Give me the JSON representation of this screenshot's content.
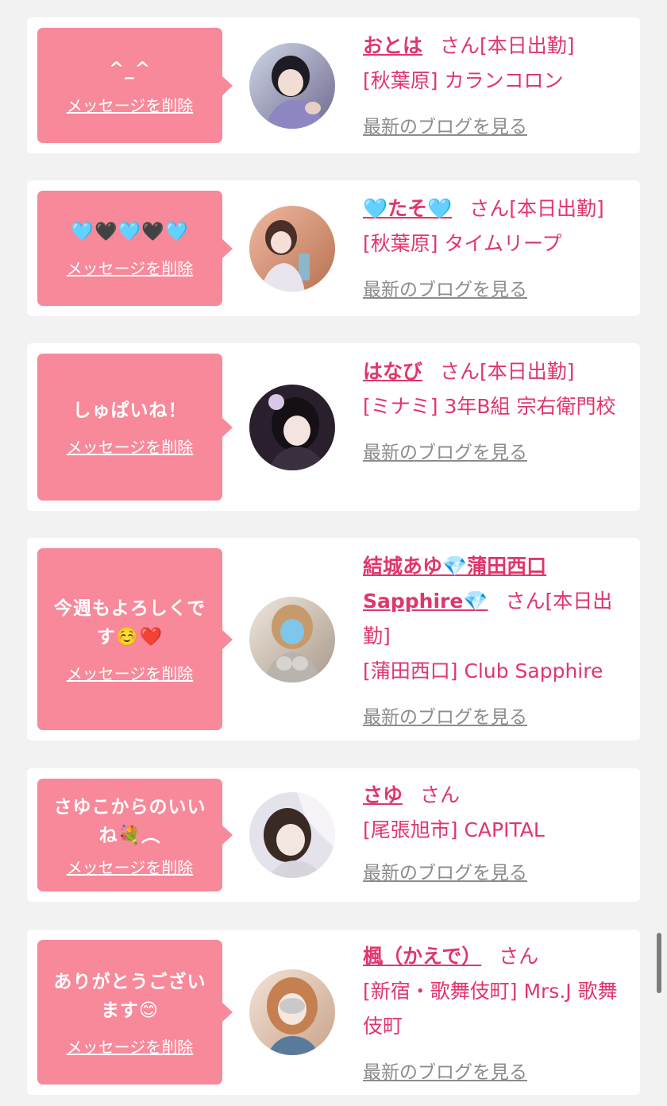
{
  "delete_label": "メッセージを削除",
  "blog_label": "最新のブログを見る",
  "san_suffix": "さん",
  "entries": [
    {
      "message": "^_^",
      "name": "おとは",
      "status": "[本日出勤]",
      "area_shop": "[秋葉原] カランコロン"
    },
    {
      "message": "🩵🖤🩵🖤🩵",
      "name": "🩵たそ🩵",
      "status": "[本日出勤]",
      "area_shop": "[秋葉原] タイムリープ"
    },
    {
      "message": "しゅぱいね！",
      "name": "はなび",
      "status": "[本日出勤]",
      "area_shop": "[ミナミ] 3年B組 宗右衛門校"
    },
    {
      "message": "今週もよろしくです☺️❤️",
      "name": "結城あゆ💎蒲田西口Sapphire💎",
      "status": "[本日出勤]",
      "area_shop": "[蒲田西口] Club Sapphire"
    },
    {
      "message": "さゆこからのいいね💐︵",
      "name": "さゆ",
      "status": "",
      "area_shop": "[尾張旭市] CAPITAL"
    },
    {
      "message": "ありがとうございます😊",
      "name": "楓（かえで）",
      "status": "",
      "area_shop": "[新宿・歌舞伎町] Mrs.J 歌舞伎町"
    }
  ],
  "colors": {
    "background": "#f2f2f2",
    "card": "#ffffff",
    "bubble": "#f7899a",
    "accent": "#e0366b",
    "blog_link": "#8c8c8c"
  }
}
